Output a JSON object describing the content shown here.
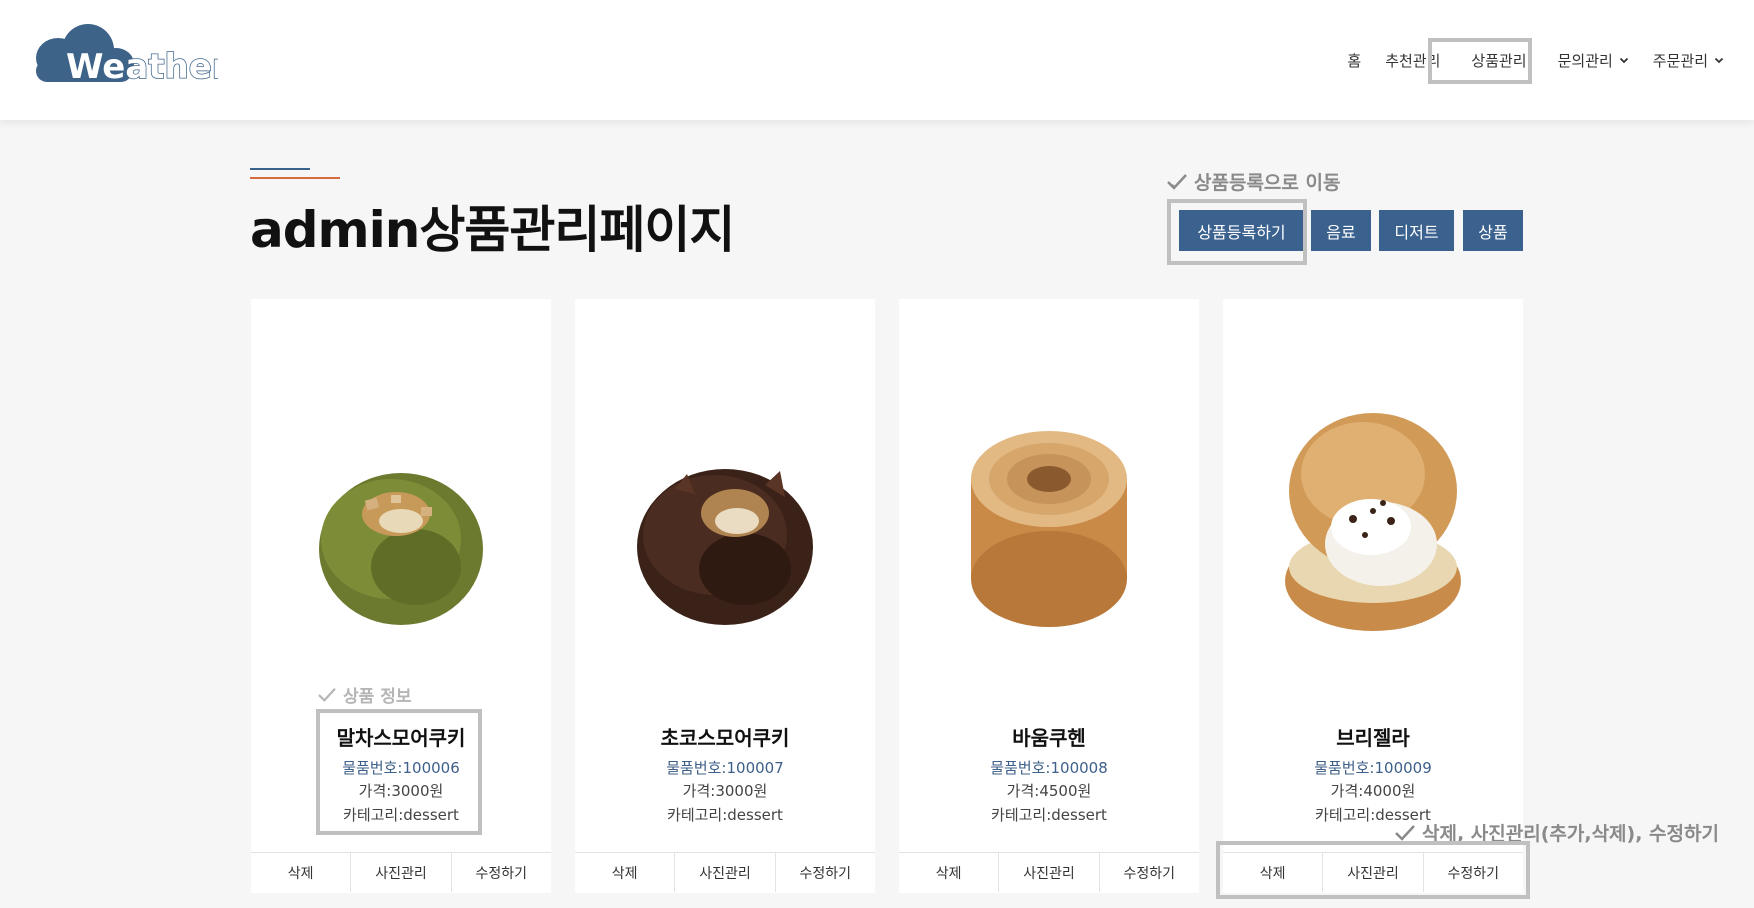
{
  "header": {
    "logo_text": "Weather",
    "nav": [
      {
        "label": "홈"
      },
      {
        "label": "추천관리"
      },
      {
        "label": "상품관리"
      },
      {
        "label": "문의관리"
      },
      {
        "label": "주문관리"
      }
    ]
  },
  "main": {
    "title": "admin상품관리페이지",
    "toolbar": {
      "annotation": "상품등록으로 이동",
      "buttons": [
        "상품등록하기",
        "음료",
        "디저트",
        "상품"
      ]
    },
    "annotations": {
      "product_info": "상품 정보",
      "actions": "삭제, 사진관리(추가,삭제), 수정하기"
    },
    "products": [
      {
        "name": "말차스모어쿠키",
        "id": "물품번호:100006",
        "price": "가격:3000원",
        "category": "카테고리:dessert"
      },
      {
        "name": "초코스모어쿠키",
        "id": "물품번호:100007",
        "price": "가격:3000원",
        "category": "카테고리:dessert"
      },
      {
        "name": "바움쿠헨",
        "id": "물품번호:100008",
        "price": "가격:4500원",
        "category": "카테고리:dessert"
      },
      {
        "name": "브리젤라",
        "id": "물품번호:100009",
        "price": "가격:4000원",
        "category": "카테고리:dessert"
      }
    ],
    "card_actions": [
      "삭제",
      "사진관리",
      "수정하기"
    ]
  },
  "colors": {
    "accent": "#3b628f",
    "accent_orange": "#d5693f",
    "highlight_box": "#c0c0c0",
    "annotation_text": "#8a8a8a"
  },
  "icons": {
    "logo": "cloud-logo-icon",
    "annotation": "check-icon",
    "dropdown": "chevron-down-icon"
  }
}
